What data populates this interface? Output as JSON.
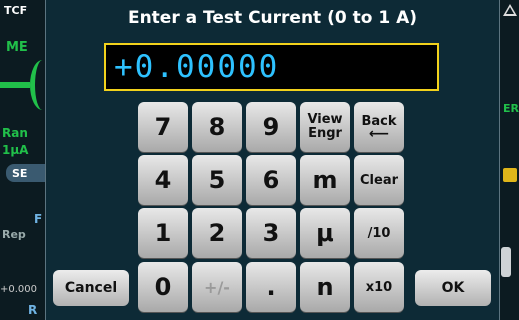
{
  "background": {
    "top_left_label": "TCF",
    "left_label_1": "ME",
    "left_label_range": "Ran",
    "left_label_unit": "1µA",
    "left_tab": "SE",
    "left_label_f": "F",
    "left_label_rep": "Rep",
    "left_value": "+0.000",
    "left_label_r": "R",
    "right_label": "ER"
  },
  "dialog": {
    "title": "Enter a Test Current (0 to 1 A)",
    "display_value": "+0.00000"
  },
  "keypad": {
    "k7": "7",
    "k8": "8",
    "k9": "9",
    "k4": "4",
    "k5": "5",
    "k6": "6",
    "k1": "1",
    "k2": "2",
    "k3": "3",
    "k0": "0",
    "plusminus": "+/-",
    "dot": ".",
    "view_engr_line1": "View",
    "view_engr_line2": "Engr",
    "back_label": "Back",
    "back_arrow": "⟵",
    "m": "m",
    "clear": "Clear",
    "mu": "μ",
    "div10": "/10",
    "n": "n",
    "x10": "x10"
  },
  "buttons": {
    "cancel": "Cancel",
    "ok": "OK"
  },
  "colors": {
    "display_text": "#2ec2ff",
    "display_border": "#f2d21c",
    "dialog_bg": "#0d2a36"
  }
}
